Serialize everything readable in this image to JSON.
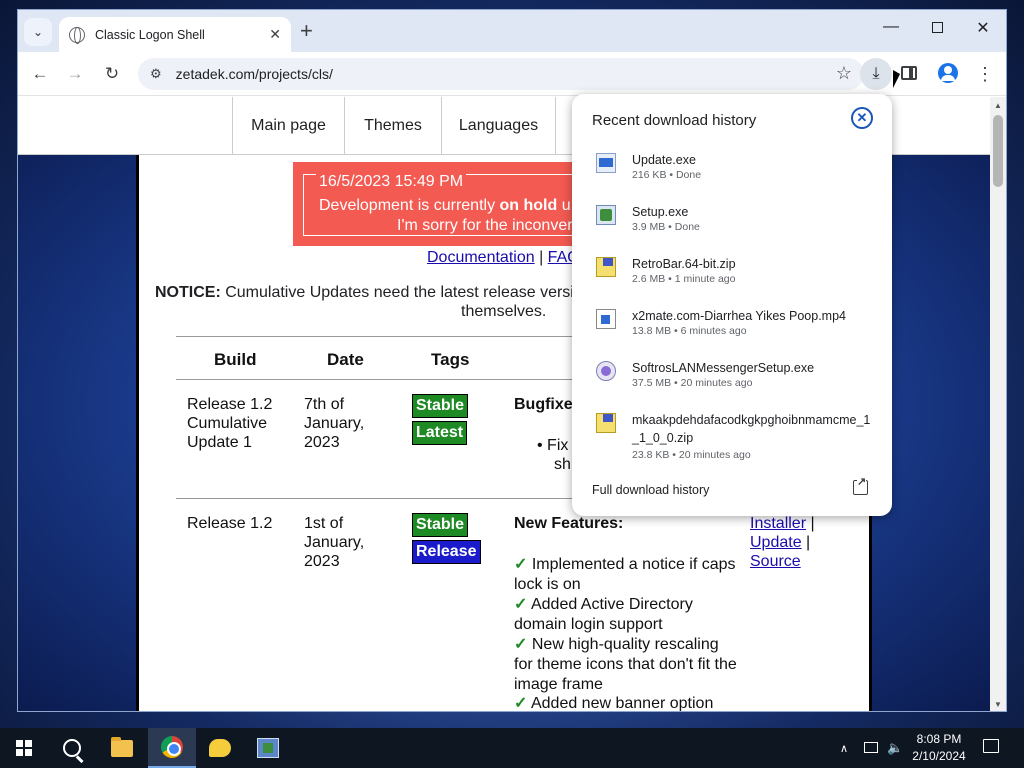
{
  "browser": {
    "tab_title": "Classic Logon Shell",
    "tab_close": "✕",
    "new_tab": "+",
    "tab_search": "⌄",
    "window_min": "—",
    "window_close": "✕",
    "url": "zetadek.com/projects/cls/",
    "back": "←",
    "forward": "→",
    "reload": "↻",
    "bookmark_star": "☆",
    "download": "⤓",
    "menu": "⋮"
  },
  "site": {
    "nav": [
      "Main page",
      "Themes",
      "Languages"
    ],
    "notice_date": "16/5/2023 15:49 PM",
    "notice_line1_pre": "Development is currently ",
    "notice_line1_bold": "on hold",
    "notice_line1_post": " u",
    "notice_line2": "I'm sorry for the inconver",
    "doc_link": "Documentation",
    "doc_sep": " | ",
    "faq_link": "FAQ",
    "cum_notice_label": "NOTICE:",
    "cum_notice_text": " Cumulative Updates need the latest release versi",
    "cum_notice_text2": "themselves.",
    "table": {
      "headers": [
        "Build",
        "Date",
        "Tags"
      ],
      "rows": [
        {
          "build": [
            "Release 1.2",
            "Cumulative",
            "Update 1"
          ],
          "date": [
            "7th of",
            "January,",
            "2023"
          ],
          "tags": [
            "Stable",
            "Latest"
          ],
          "section": "Bugfixe",
          "bullet_1": "Fix",
          "bullet_2": "sh"
        },
        {
          "build": [
            "Release 1.2"
          ],
          "date": [
            "1st of",
            "January,",
            "2023"
          ],
          "tags": [
            "Stable",
            "Release"
          ],
          "section": "New Features:",
          "features": [
            "Implemented a notice if caps lock is on",
            "Added Active Directory domain login support",
            "New high-quality rescaling for theme icons that don't fit the image frame",
            "Added new banner option"
          ],
          "links": [
            "Installer",
            "Update",
            "Source"
          ]
        }
      ]
    }
  },
  "downloads": {
    "header": "Recent download history",
    "items": [
      {
        "name": "Update.exe",
        "meta": "216 KB • Done",
        "icon": "exe-icon"
      },
      {
        "name": "Setup.exe",
        "meta": "3.9 MB • Done",
        "icon": "setup-icon"
      },
      {
        "name": "RetroBar.64-bit.zip",
        "meta": "2.6 MB • 1 minute ago",
        "icon": "zip-icon"
      },
      {
        "name": "x2mate.com-Diarrhea Yikes Poop.mp4",
        "meta": "13.8 MB • 6 minutes ago",
        "icon": "video-file-icon"
      },
      {
        "name": "SoftrosLANMessengerSetup.exe",
        "meta": "37.5 MB • 20 minutes ago",
        "icon": "messenger-installer-icon"
      },
      {
        "name": "mkaakpdehdafacodkgkpghoibnmamcme_1_1_0_0.zip",
        "meta": "23.8 KB • 20 minutes ago",
        "icon": "zip-icon"
      }
    ],
    "full_history": "Full download history"
  },
  "taskbar": {
    "time": "8:08 PM",
    "date": "2/10/2024",
    "chevron": "∧",
    "volume": "🔈"
  }
}
